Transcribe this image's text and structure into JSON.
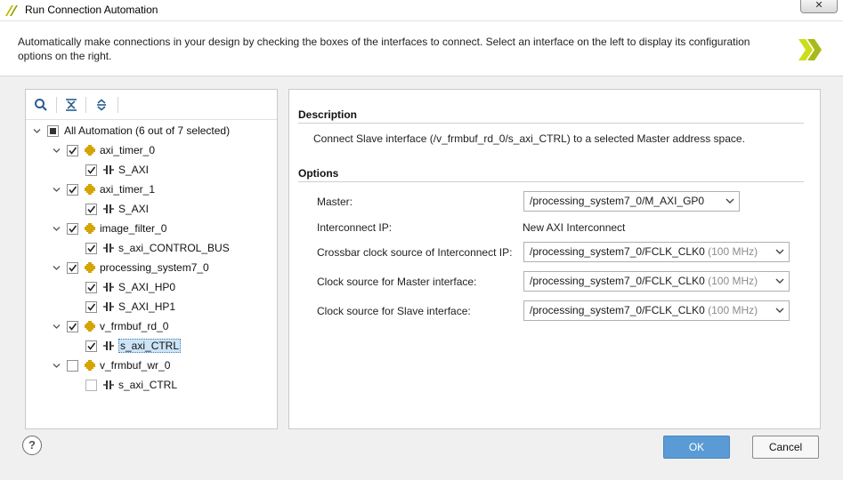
{
  "window": {
    "title": "Run Connection Automation",
    "close_glyph": "✕"
  },
  "header": {
    "description": "Automatically make connections in your design by checking the boxes of the interfaces to connect. Select an interface on the left to display its configuration options on the right."
  },
  "toolbar": {
    "icons": [
      "search-icon",
      "collapse-all-icon",
      "expand-all-icon"
    ]
  },
  "tree": {
    "root": {
      "label": "All Automation (6 out of 7 selected)",
      "state": "partial"
    },
    "nodes": [
      {
        "label": "axi_timer_0",
        "checked": true,
        "children": [
          {
            "label": "S_AXI",
            "checked": true
          }
        ]
      },
      {
        "label": "axi_timer_1",
        "checked": true,
        "children": [
          {
            "label": "S_AXI",
            "checked": true
          }
        ]
      },
      {
        "label": "image_filter_0",
        "checked": true,
        "children": [
          {
            "label": "s_axi_CONTROL_BUS",
            "checked": true
          }
        ]
      },
      {
        "label": "processing_system7_0",
        "checked": true,
        "children": [
          {
            "label": "S_AXI_HP0",
            "checked": true
          },
          {
            "label": "S_AXI_HP1",
            "checked": true
          }
        ]
      },
      {
        "label": "v_frmbuf_rd_0",
        "checked": true,
        "children": [
          {
            "label": "s_axi_CTRL",
            "checked": true,
            "selected": true
          }
        ]
      },
      {
        "label": "v_frmbuf_wr_0",
        "checked": false,
        "children": [
          {
            "label": "s_axi_CTRL",
            "checked": false
          }
        ]
      }
    ]
  },
  "description_section": {
    "title": "Description",
    "text": "Connect Slave interface (/v_frmbuf_rd_0/s_axi_CTRL) to a selected Master address space."
  },
  "options_section": {
    "title": "Options",
    "master": {
      "label": "Master:",
      "value": "/processing_system7_0/M_AXI_GP0"
    },
    "interconnect_ip": {
      "label": "Interconnect IP:",
      "value": "New AXI Interconnect"
    },
    "crossbar_clock": {
      "label": "Crossbar clock source of Interconnect IP:",
      "value": "/processing_system7_0/FCLK_CLK0",
      "suffix": " (100 MHz)"
    },
    "master_clock": {
      "label": "Clock source for Master interface:",
      "value": "/processing_system7_0/FCLK_CLK0",
      "suffix": " (100 MHz)"
    },
    "slave_clock": {
      "label": "Clock source for Slave interface:",
      "value": "/processing_system7_0/FCLK_CLK0",
      "suffix": " (100 MHz)"
    }
  },
  "footer": {
    "help_glyph": "?",
    "ok_label": "OK",
    "cancel_label": "Cancel"
  },
  "colors": {
    "accent": "#5b9bd5",
    "selection": "#cce4f7",
    "ip_icon": "#d4a400"
  }
}
